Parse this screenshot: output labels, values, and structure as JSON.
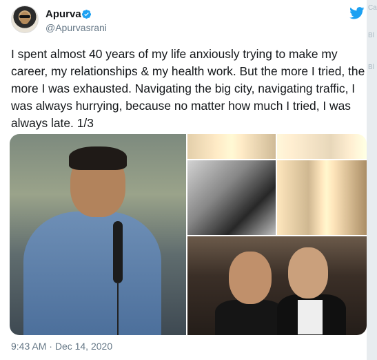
{
  "tweet": {
    "author_name": "Apurva",
    "handle": "@Apurvasrani",
    "verified": true,
    "text": "I spent almost 40 years of my life anxiously trying to make my career, my relationships & my health work. But the more I tried, the more I was exhausted. Navigating the big city, navigating traffic, I was always hurrying, because no matter how much I tried, I was always late. 1/3",
    "time": "9:43 AM",
    "separator": "·",
    "date": "Dec 14, 2020",
    "icons": {
      "verified": "verified-badge-icon",
      "platform": "twitter-bird-icon"
    }
  },
  "edge": {
    "top": "Ca",
    "mid1": "Bl",
    "mid2": "Bl"
  },
  "colors": {
    "accent": "#1da1f2",
    "text": "#14171a",
    "secondary": "#657786"
  }
}
